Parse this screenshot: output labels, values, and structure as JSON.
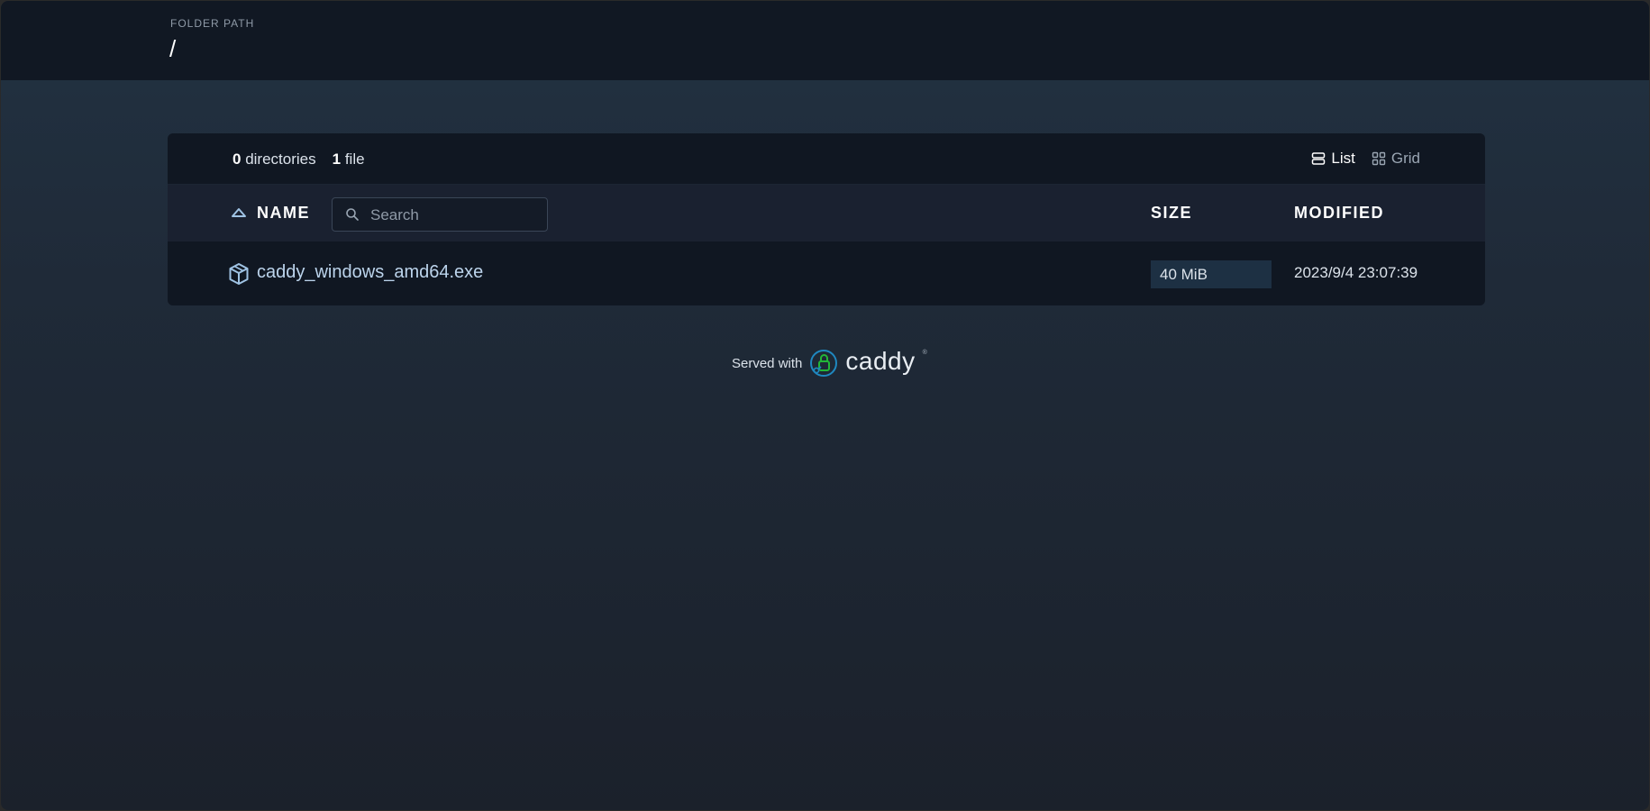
{
  "header": {
    "path_label": "FOLDER PATH",
    "path": "/"
  },
  "summary": {
    "dir_count": "0",
    "dir_label": "directories",
    "file_count": "1",
    "file_label": "file"
  },
  "view": {
    "list_label": "List",
    "grid_label": "Grid",
    "active": "list"
  },
  "columns": {
    "name": "NAME",
    "size": "SIZE",
    "modified": "MODIFIED"
  },
  "search": {
    "placeholder": "Search",
    "value": ""
  },
  "files": [
    {
      "name": "caddy_windows_amd64.exe",
      "size": "40 MiB",
      "modified": "2023/9/4 23:07:39",
      "icon": "package-icon"
    }
  ],
  "footer": {
    "served_with": "Served with",
    "brand": "caddy"
  },
  "colors": {
    "accent": "#bcd4ec",
    "size_badge": "#1d3043",
    "caddy_green": "#22b638",
    "caddy_blue": "#1f88c0"
  }
}
